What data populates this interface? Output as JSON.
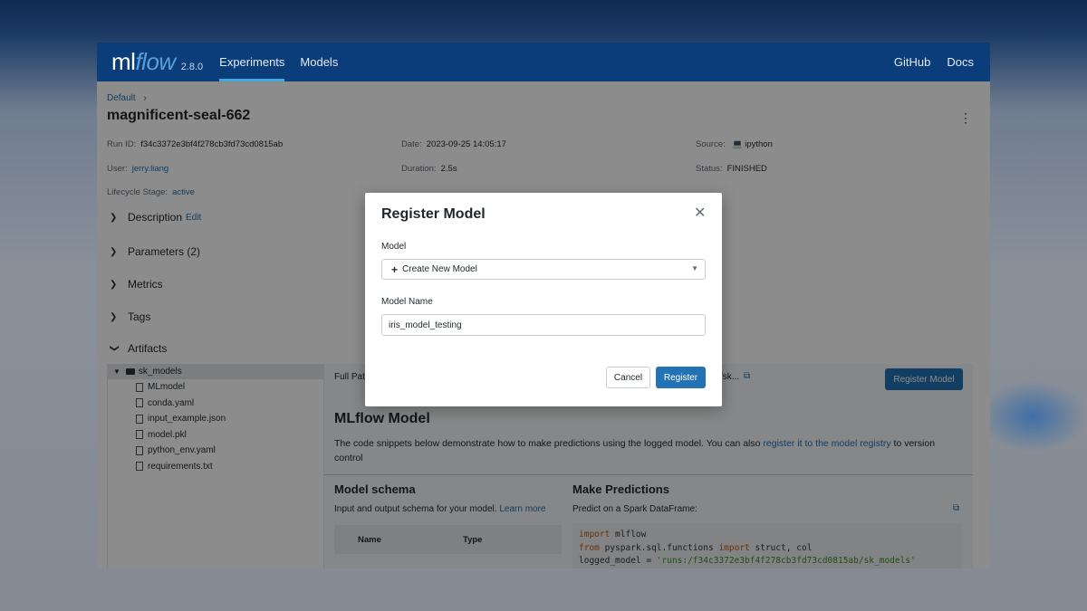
{
  "header": {
    "logo_ml": "ml",
    "logo_flow": "flow",
    "version": "2.8.0",
    "nav": [
      "Experiments",
      "Models"
    ],
    "nav_right": [
      "GitHub",
      "Docs"
    ]
  },
  "run": {
    "breadcrumb": "Default",
    "breadcrumb_sep": "›",
    "title": "magnificent-seal-662",
    "kebab": "⋮",
    "run_id_label": "Run ID:",
    "run_id": "f34c3372e3bf4f278cb3fd73cd0815ab",
    "date_label": "Date:",
    "date": "2023-09-25 14:05:17",
    "source_label": "Source:",
    "source": "ipython",
    "user_label": "User:",
    "user": "jerry.liang",
    "duration_label": "Duration:",
    "duration": "2.5s",
    "status_label": "Status:",
    "status": "FINISHED",
    "lifecycle_label": "Lifecycle Stage:",
    "lifecycle": "active"
  },
  "sections": {
    "description": "Description",
    "edit": "Edit",
    "parameters": "Parameters (2)",
    "metrics": "Metrics",
    "tags": "Tags",
    "artifacts": "Artifacts"
  },
  "tree": {
    "root": "sk_models",
    "files": [
      "MLmodel",
      "conda.yaml",
      "input_example.json",
      "model.pkl",
      "python_env.yaml",
      "requirements.txt"
    ]
  },
  "detail": {
    "full_path_label": "Full Path",
    "path_tail": "/sk...",
    "register_button": "Register Model",
    "mlflow_model_heading": "MLflow Model",
    "desc_text": "The code snippets below demonstrate how to make predictions using the logged model. You can also ",
    "desc_link": "register it to the model registry",
    "desc_tail": " to version control",
    "schema_heading": "Model schema",
    "schema_sub": "Input and output schema for your model. ",
    "schema_learn_more": "Learn more",
    "schema_col_name": "Name",
    "schema_col_type": "Type",
    "predict_heading": "Make Predictions",
    "predict_sub": "Predict on a Spark DataFrame:",
    "code": {
      "l1_kw": "import",
      "l1_rest": " mlflow",
      "l2_kw1": "from",
      "l2_mid": " pyspark.sql.functions ",
      "l2_kw2": "import",
      "l2_rest": " struct, col",
      "l3_pre": "logged_model = ",
      "l3_str": "'runs:/f34c3372e3bf4f278cb3fd73cd0815ab/sk_models'"
    }
  },
  "modal": {
    "title": "Register Model",
    "close": "✕",
    "model_label": "Model",
    "model_select_plus": "+",
    "model_select_value": "Create New Model",
    "model_name_label": "Model Name",
    "model_name_value": "iris_model_testing",
    "cancel": "Cancel",
    "register": "Register"
  }
}
